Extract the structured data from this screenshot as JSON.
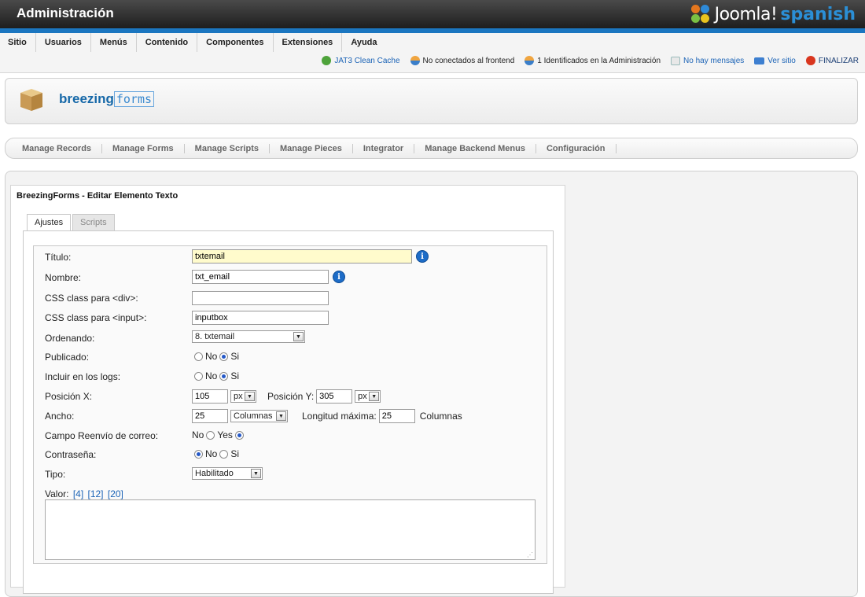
{
  "header": {
    "title": "Administración",
    "brand_word1": "Joomla!",
    "brand_word2": "spanish"
  },
  "mainmenu": [
    "Sitio",
    "Usuarios",
    "Menús",
    "Contenido",
    "Componentes",
    "Extensiones",
    "Ayuda"
  ],
  "status": [
    {
      "text": "JAT3 Clean Cache",
      "icon": "recycle-icon",
      "link": true
    },
    {
      "text": "No conectados al frontend",
      "icon": "users-icon",
      "link": false
    },
    {
      "text": "1 Identificados en la Administración",
      "icon": "user-icon",
      "link": false
    },
    {
      "text": "No hay mensajes",
      "icon": "message-icon",
      "link": true
    },
    {
      "text": "Ver sitio",
      "icon": "monitor-icon",
      "link": true
    },
    {
      "text": "FINALIZAR",
      "icon": "logout-icon",
      "link": false
    }
  ],
  "logo": {
    "bold": "breezing",
    "rest": "forms"
  },
  "subnav": [
    "Manage Records",
    "Manage Forms",
    "Manage Scripts",
    "Manage Pieces",
    "Integrator",
    "Manage Backend Menus",
    "Configuración"
  ],
  "form": {
    "title": "BreezingForms - Editar Elemento Texto",
    "tabs": [
      "Ajustes",
      "Scripts"
    ],
    "labels": {
      "titulo": "Título:",
      "nombre": "Nombre:",
      "css_div": "CSS class para <div>:",
      "css_input": "CSS class para <input>:",
      "ordenando": "Ordenando:",
      "publicado": "Publicado:",
      "logs": "Incluir en los logs:",
      "posx": "Posición X:",
      "ancho": "Ancho:",
      "reenvio": "Campo Reenvío de correo:",
      "contrasena": "Contraseña:",
      "tipo": "Tipo:",
      "valor": "Valor:"
    },
    "values": {
      "titulo": "txtemail",
      "nombre": "txt_email",
      "css_div": "",
      "css_input": "inputbox",
      "ordenando": "8. txtemail",
      "posx": "105",
      "posx_unit": "px",
      "posy_label": "Posición Y:",
      "posy": "305",
      "posy_unit": "px",
      "ancho": "25",
      "ancho_unit": "Columnas",
      "longmax_label": "Longitud máxima:",
      "longmax": "25",
      "longmax_unit": "Columnas",
      "tipo": "Habilitado",
      "valor": ""
    },
    "radios": {
      "no": "No",
      "si": "Si",
      "yes": "Yes",
      "publicado": "Si",
      "logs": "Si",
      "reenvio": "Yes",
      "contrasena": "No"
    },
    "valor_links": [
      "[4]",
      "[12]",
      "[20]"
    ]
  },
  "colors": {
    "accent": "#1b76c0",
    "link": "#1b63b6",
    "title_bg": "#fffbcc"
  }
}
